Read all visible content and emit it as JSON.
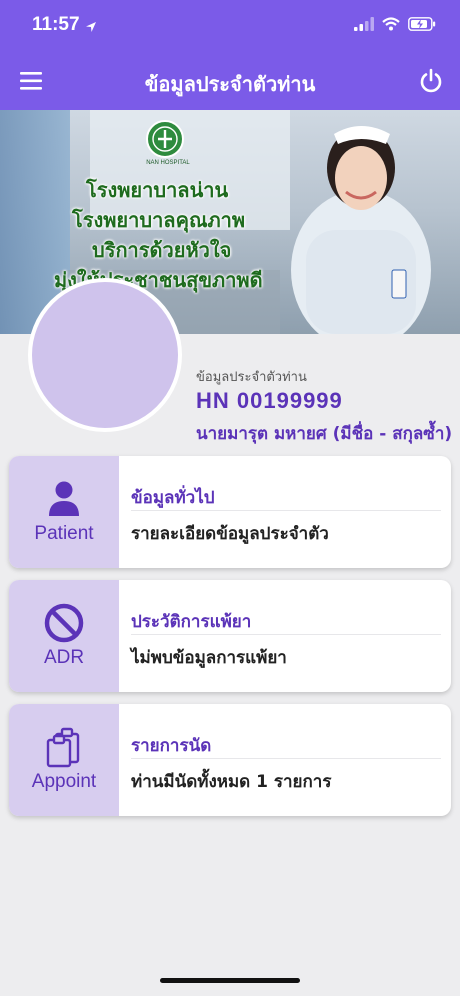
{
  "status": {
    "time": "11:57"
  },
  "nav": {
    "title": "ข้อมูลประจำตัวท่าน"
  },
  "banner": {
    "logo_caption": "NAN HOSPITAL",
    "lines": [
      "โรงพยาบาลน่าน",
      "โรงพยาบาลคุณภาพ",
      "บริการด้วยหัวใจ",
      "มุ่งให้ประชาชนสุขภาพดี"
    ]
  },
  "profile": {
    "caption": "ข้อมูลประจำตัวท่าน",
    "hn": "HN  00199999",
    "name": "นายมารุต  มหายศ (มีชื่อ - สกุลซ้ำ)"
  },
  "cards": [
    {
      "side_label": "Patient",
      "icon": "person-icon",
      "title": "ข้อมูลทั่วไป",
      "desc": "รายละเอียดข้อมูลประจำตัว"
    },
    {
      "side_label": "ADR",
      "icon": "prohibited-icon",
      "title": "ประวัติการแพ้ยา",
      "desc": "ไม่พบข้อมูลการแพ้ยา"
    },
    {
      "side_label": "Appoint",
      "icon": "clipboard-icon",
      "title": "รายการนัด",
      "desc": "ท่านมีนัดทั้งหมด 1 รายการ"
    }
  ],
  "colors": {
    "primary": "#7b5be8",
    "accent_text": "#5b33b8",
    "card_side": "#d7cdef",
    "background": "#ededef"
  }
}
